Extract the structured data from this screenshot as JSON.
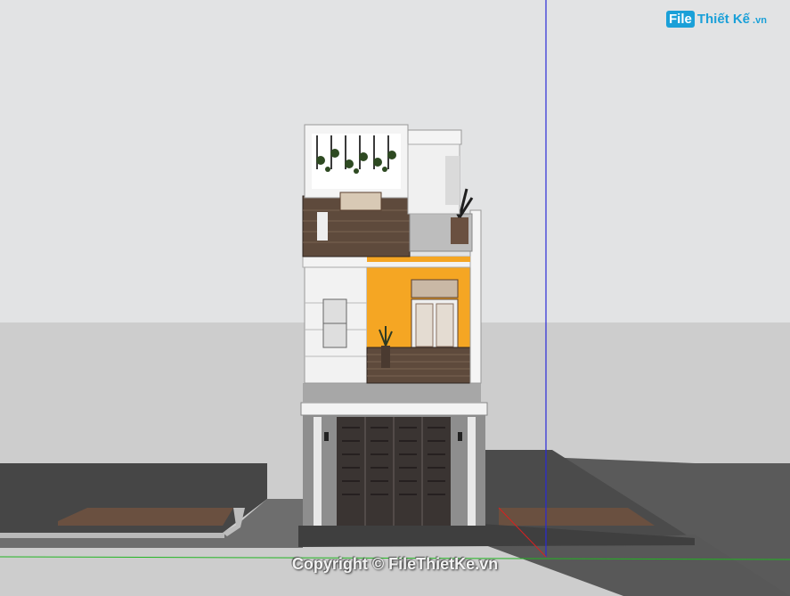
{
  "watermark": {
    "logo_box": "File",
    "logo_text": "Thiết Kế",
    "logo_suffix": ".vn"
  },
  "copyright": "Copyright © FileThietKe.vn",
  "colors": {
    "sky": "#dcdee0",
    "ground": "#cfcfcf",
    "road": "#4a4a4a",
    "facade_orange": "#f5a623",
    "wood": "#5e4a3c",
    "axis_blue": "#2a2ad8",
    "axis_green": "#22b522",
    "axis_red": "#d82020"
  }
}
